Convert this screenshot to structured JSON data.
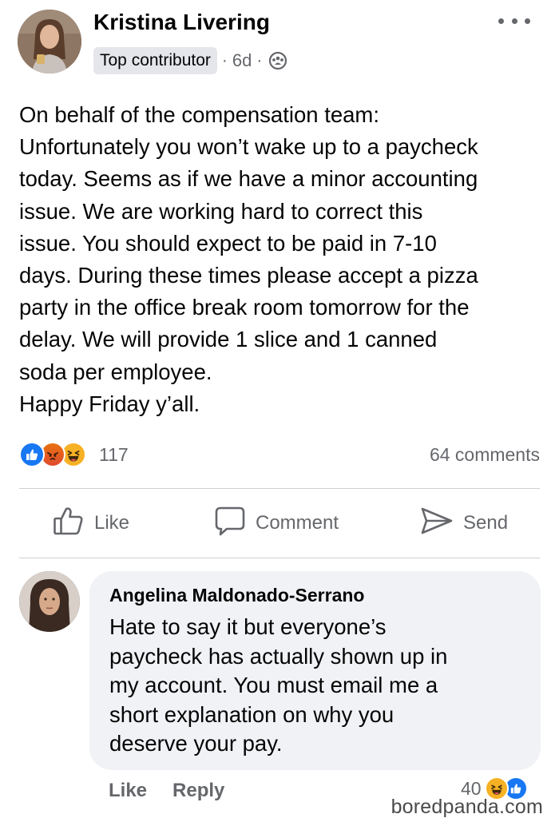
{
  "post": {
    "author": "Kristina Livering",
    "badge": "Top contributor",
    "sep1": "·",
    "time": "6d",
    "sep2": "·",
    "body_lines": [
      "On behalf of the compensation team:",
      "Unfortunately you won’t wake up to a paycheck",
      "today. Seems as if we have a minor accounting",
      "issue. We are working hard to correct this",
      "issue. You should expect to be paid in 7-10",
      "days. During these times please accept a pizza",
      "party in the office break room tomorrow for the",
      "delay. We will provide 1 slice and 1 canned",
      "soda per employee.",
      "Happy Friday y’all."
    ],
    "reaction_count": "117",
    "comment_count": "64 comments",
    "reaction_icons": [
      "like-icon",
      "angry-icon",
      "haha-icon"
    ]
  },
  "actions": {
    "like": "Like",
    "comment": "Comment",
    "send": "Send"
  },
  "comment": {
    "author": "Angelina Maldonado-Serrano",
    "text_lines": [
      "Hate to say it but everyone’s",
      "paycheck has actually shown up in",
      "my account. You must email me a",
      "short explanation on why you",
      "deserve your pay."
    ],
    "like_label": "Like",
    "reply_label": "Reply",
    "reaction_count": "40",
    "reaction_icons": [
      "haha-icon",
      "like-icon"
    ]
  },
  "watermark": "boredpanda.com",
  "colors": {
    "text": "#050505",
    "secondary": "#65676b",
    "bubble": "#f0f2f5",
    "badge": "#e4e6eb",
    "like_blue": "#1877f2",
    "haha_yellow": "#f7b125",
    "angry_orange": "#e9710f"
  }
}
